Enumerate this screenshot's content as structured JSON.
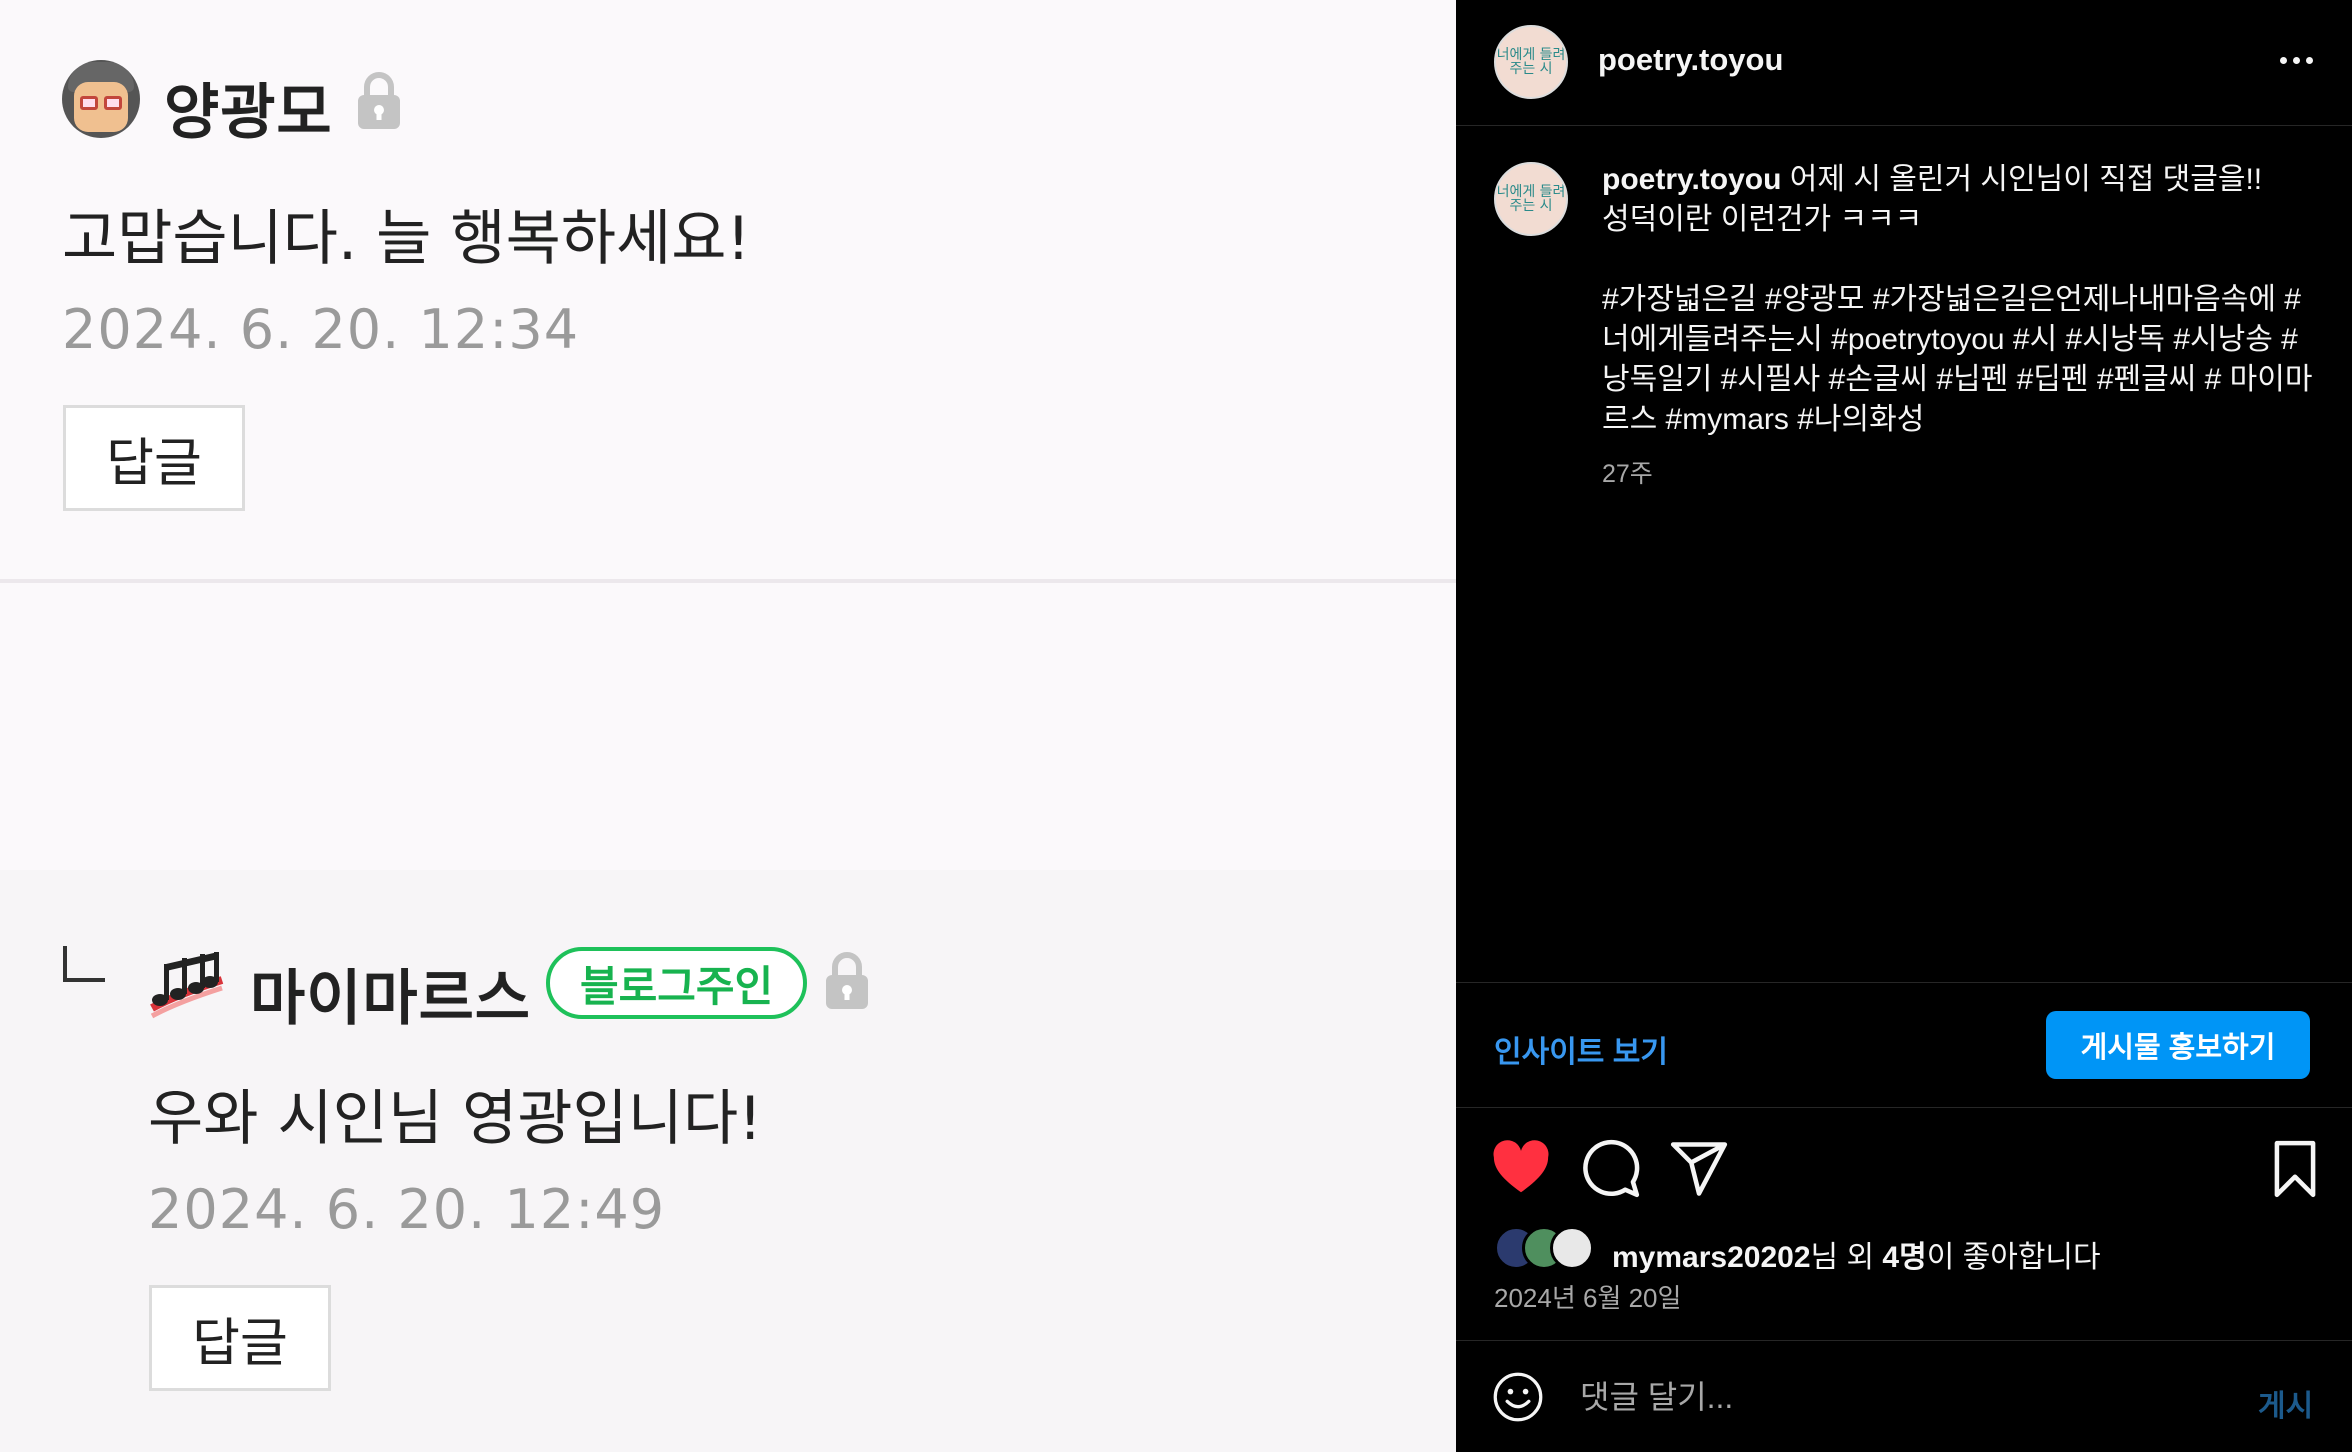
{
  "blog": {
    "comment1": {
      "author": "양광모",
      "text": "고맙습니다. 늘 행복하세요!",
      "date": "2024. 6. 20. 12:34",
      "reply_label": "답글"
    },
    "comment2": {
      "author": "마이마르스",
      "badge": "블로그주인",
      "text": "우와 시인님 영광입니다!",
      "date": "2024. 6. 20. 12:49",
      "reply_label": "답글"
    }
  },
  "instagram": {
    "account": "poetry.toyou",
    "avatar_text": "너에게 들려주는 시",
    "caption": {
      "username": "poetry.toyou",
      "line1": "어제 시 올린거 시인님이 직접 댓글을!!",
      "line2": "성덕이란 이런건가 ㅋㅋㅋ",
      "hashtags": "#가장넓은길 #양광모 #가장넓은길은언제나내마음속에 #너에게들려주는시 #poetrytoyou #시 #시낭독 #시낭송 #낭독일기 #시필사 #손글씨 #닙펜 #딥펜 #펜글씨 # 마이마르스 #mymars #나의화성",
      "age": "27주"
    },
    "insight_label": "인사이트 보기",
    "promote_label": "게시물 홍보하기",
    "icons": {
      "like": "heart-icon",
      "comment": "comment-icon",
      "share": "send-icon",
      "save": "bookmark-icon",
      "more": "more-icon",
      "emoji": "emoji-icon"
    },
    "like_color": "#ff3040",
    "likes": {
      "user": "mymars20202",
      "mid": "님 외 ",
      "count": "4명",
      "suffix": "이 좋아합니다"
    },
    "date": "2024년 6월 20일",
    "comment_placeholder": "댓글 달기...",
    "post_label": "게시"
  }
}
